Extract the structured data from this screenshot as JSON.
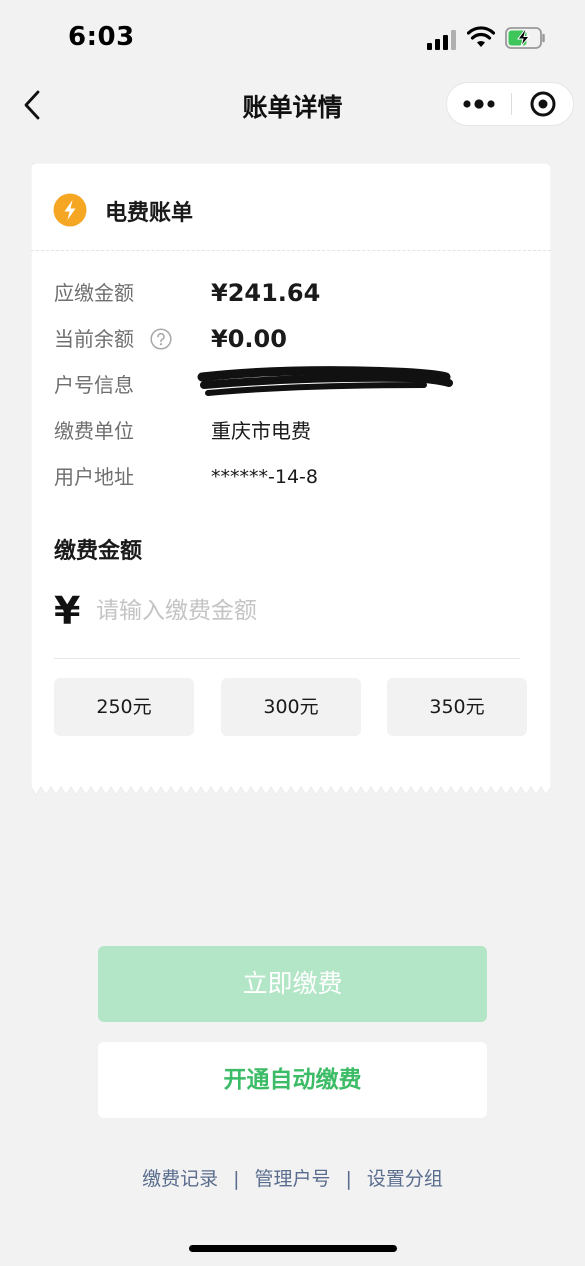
{
  "status_bar": {
    "time": "6:03",
    "signal_icon": "cellular-signal-icon",
    "wifi_icon": "wifi-icon",
    "battery_icon": "battery-charging-icon"
  },
  "nav": {
    "title": "账单详情",
    "back_icon": "chevron-left-icon",
    "more_icon": "more-dots-icon",
    "close_icon": "target-circle-icon"
  },
  "bill": {
    "header_title": "电费账单",
    "header_icon": "lightning-bolt-icon",
    "rows": [
      {
        "label": "应缴金额",
        "value": "¥241.64"
      },
      {
        "label": "当前余额",
        "value": "¥0.00"
      },
      {
        "label": "户号信息",
        "value": ""
      },
      {
        "label": "缴费单位",
        "value": "重庆市电费"
      },
      {
        "label": "用户地址",
        "value": "******-14-8"
      }
    ],
    "pay_section_title": "缴费金额",
    "currency_symbol": "¥",
    "amount_placeholder": "请输入缴费金额",
    "presets": [
      "250元",
      "300元",
      "350元"
    ]
  },
  "actions": {
    "pay_now": "立即缴费",
    "autopay": "开通自动缴费"
  },
  "footer": {
    "links": [
      "缴费记录",
      "管理户号",
      "设置分组"
    ],
    "separator": "|"
  },
  "colors": {
    "page_background": "#f2f2f2",
    "accent_green": "#3cbc66",
    "pay_button_disabled": "#b3e6c7",
    "bolt_orange": "#f5a623",
    "footer_link": "#5a6d8f"
  }
}
